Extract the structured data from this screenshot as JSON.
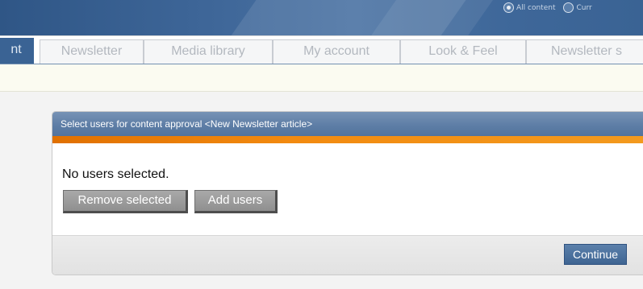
{
  "header": {
    "radio_options": [
      {
        "label": "All content",
        "checked": true
      },
      {
        "label": "Curr",
        "checked": false
      }
    ]
  },
  "tabs": [
    {
      "label": "nt",
      "active": true
    },
    {
      "label": "Newsletter",
      "active": false
    },
    {
      "label": "Media library",
      "active": false
    },
    {
      "label": "My account",
      "active": false
    },
    {
      "label": "Look & Feel",
      "active": false
    },
    {
      "label": "Newsletter s",
      "active": false
    }
  ],
  "dialog": {
    "title": "Select users for content approval <New Newsletter article>",
    "status_text": "No users selected.",
    "remove_button": "Remove selected",
    "add_button": "Add users",
    "continue_button": "Continue"
  },
  "colors": {
    "header_blue": "#3a6394",
    "accent_orange": "#f28a10",
    "button_grey": "#9a9a9a"
  }
}
